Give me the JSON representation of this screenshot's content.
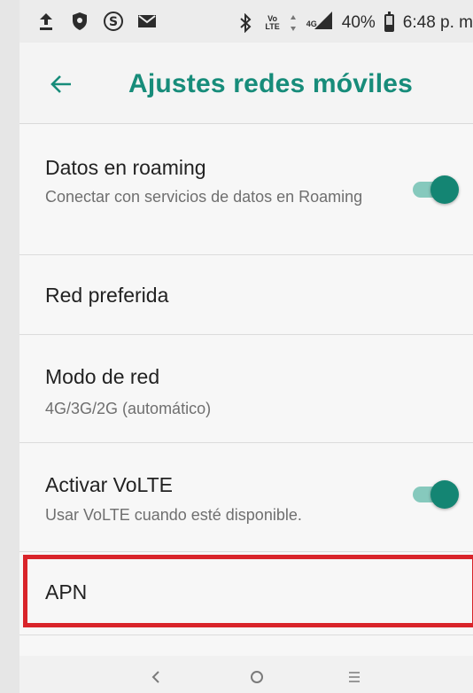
{
  "status_bar": {
    "volte_top": "Vo",
    "volte_bottom": "LTE",
    "network": "4G",
    "battery_pct": "40%",
    "battery_level": 0.4,
    "time": "6:48 p. m",
    "icons": [
      "upload-icon",
      "shield-icon",
      "skype-icon",
      "messages-icon",
      "bluetooth-icon",
      "volte-icon",
      "data-arrows-icon",
      "signal-icon",
      "battery-icon"
    ]
  },
  "app_bar": {
    "title": "Ajustes redes móviles"
  },
  "settings": [
    {
      "title": "Datos en roaming",
      "subtitle": "Conectar con servicios de datos en Roaming",
      "toggle": true
    },
    {
      "title": "Red preferida"
    },
    {
      "title": "Modo de red",
      "subtitle": "4G/3G/2G (automático)"
    },
    {
      "title": "Activar VoLTE",
      "subtitle": "Usar VoLTE cuando esté disponible.",
      "toggle": true
    },
    {
      "title": "APN",
      "highlighted": true
    }
  ],
  "colors": {
    "accent": "#178c7a",
    "toggle_thumb": "#148573",
    "toggle_track": "#86c9bd",
    "highlight": "#d9242a"
  },
  "nav_bar": {
    "icons": [
      "back-nav-icon",
      "home-nav-icon",
      "recents-nav-icon"
    ]
  }
}
